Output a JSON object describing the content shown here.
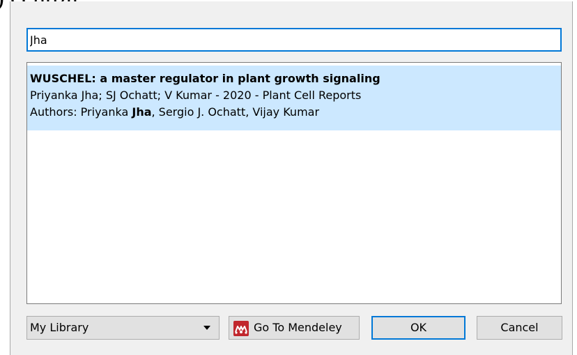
{
  "background": {
    "partial_text": ") central"
  },
  "dialog": {
    "search": {
      "value": "Jha"
    },
    "results": [
      {
        "title": "WUSCHEL: a master regulator in plant growth signaling",
        "citation": "Priyanka Jha; SJ Ochatt; V Kumar - 2020 - Plant Cell Reports",
        "authors_prefix": "Authors: Priyanka ",
        "authors_match": "Jha",
        "authors_suffix": ", Sergio J. Ochatt, Vijay Kumar"
      }
    ],
    "library_select": {
      "selected": "My Library"
    },
    "buttons": {
      "mendeley": "Go To Mendeley",
      "ok": "OK",
      "cancel": "Cancel"
    },
    "colors": {
      "accent": "#0078d7",
      "selection": "#cce8ff",
      "mendeley_brand": "#c1272d"
    }
  }
}
